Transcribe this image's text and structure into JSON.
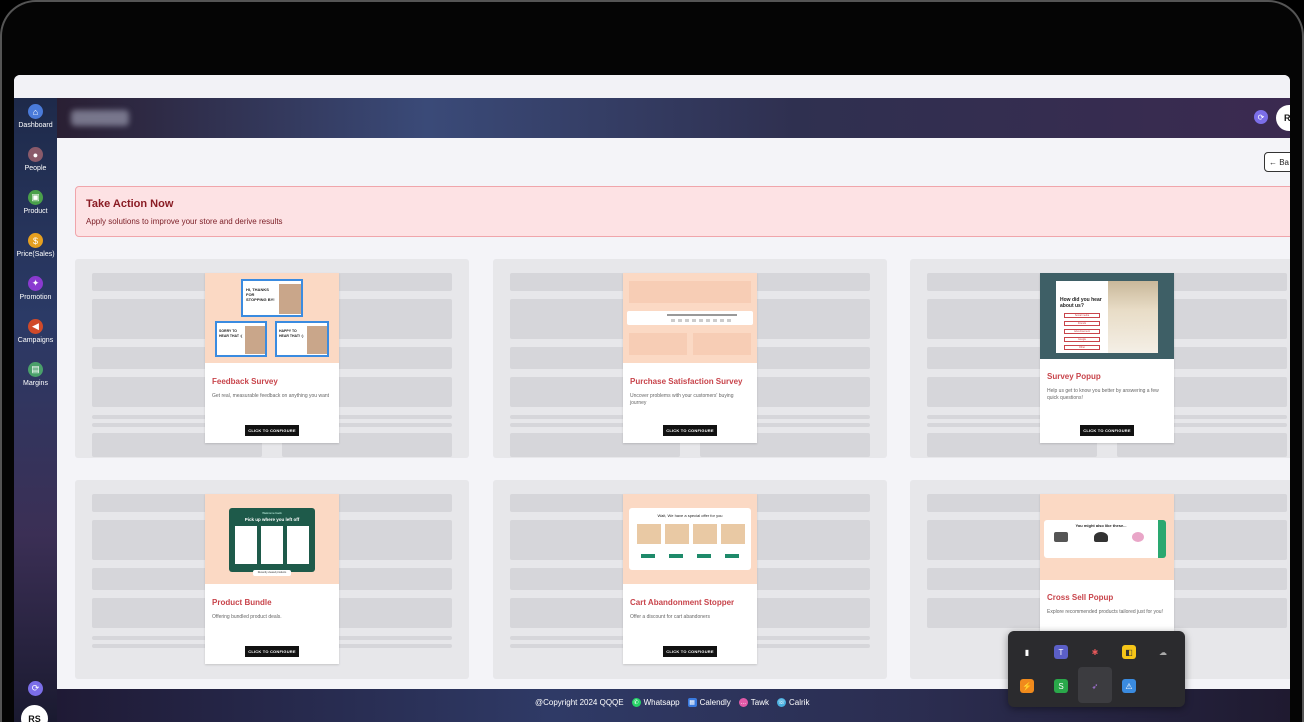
{
  "sidebar": {
    "items": [
      {
        "label": "Dashboard",
        "icon": "home-icon",
        "color": "#4a7bd9"
      },
      {
        "label": "People",
        "icon": "person-icon",
        "color": "#8a5a6a"
      },
      {
        "label": "Product",
        "icon": "bag-icon",
        "color": "#4aa04a"
      },
      {
        "label": "Price(Sales)",
        "icon": "dollar-icon",
        "color": "#e6a020"
      },
      {
        "label": "Promotion",
        "icon": "gift-icon",
        "color": "#8a3ad0"
      },
      {
        "label": "Campaigns",
        "icon": "megaphone-icon",
        "color": "#d04a2a"
      },
      {
        "label": "Margins",
        "icon": "cash-register-icon",
        "color": "#4aa06a"
      }
    ],
    "user_initials": "RS"
  },
  "header": {
    "user_initial": "R"
  },
  "back_button": {
    "label": "← Ba"
  },
  "alert": {
    "title": "Take Action Now",
    "subtitle": "Apply solutions to improve your store and derive results"
  },
  "cards": [
    {
      "title": "Feedback Survey",
      "desc": "Get real, measurable feedback on anything you want",
      "button": "CLICK TO CONFIGURE"
    },
    {
      "title": "Purchase Satisfaction Survey",
      "desc": "Uncover problems with your customers' buying journey",
      "button": "CLICK TO CONFIGURE"
    },
    {
      "title": "Survey Popup",
      "desc": "Help us get to know you better by answering a few quick questions!",
      "button": "CLICK TO CONFIGURE"
    },
    {
      "title": "Product Bundle",
      "desc": "Offering bundled product deals.",
      "button": "CLICK TO CONFIGURE"
    },
    {
      "title": "Cart Abandonment Stopper",
      "desc": "Offer a discount for cart abandoners",
      "button": "CLICK TO CONFIGURE"
    },
    {
      "title": "Cross Sell Popup",
      "desc": "Explore recommended products tailored just for you!",
      "button": "CLICK TO CONFIGURE"
    }
  ],
  "thumbs": {
    "feedback": {
      "hi": "HI, THANKS FOR STOPPING BY!",
      "sorry": "SORRY TO HEAR THAT :(",
      "happy": "HAPPY TO HEAR THAT! :)"
    },
    "survey": {
      "question": "How did you hear about us?",
      "options": [
        "Social media",
        "Friends",
        "Advertisement",
        "Google",
        "Other"
      ]
    },
    "bundle": {
      "tag": "Welcome back",
      "heading": "Pick up where you left off",
      "footer": "Recently viewed products"
    },
    "cart": {
      "heading": "Wait, We have a special offer for you"
    },
    "crosssell": {
      "heading": "You might also like these..."
    }
  },
  "footer": {
    "copyright": "@Copyright 2024 QQQE",
    "links": [
      {
        "label": "Whatsapp",
        "icon": "whatsapp-icon",
        "color": "#25d366"
      },
      {
        "label": "Calendly",
        "icon": "calendar-icon",
        "color": "#3a7be0"
      },
      {
        "label": "Tawk",
        "icon": "chat-icon",
        "color": "#e25aa8"
      },
      {
        "label": "Calrik",
        "icon": "phone-icon",
        "color": "#4ab0e0"
      }
    ]
  }
}
